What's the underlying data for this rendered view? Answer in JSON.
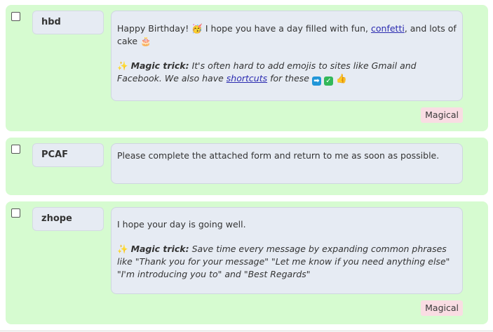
{
  "rows": [
    {
      "shortcut": "hbd",
      "message_pre": "Happy Birthday!",
      "message_mid": "I hope you have a day filled with fun,",
      "message_link": "confetti",
      "message_post": ", and lots of cake",
      "magic_label": "Magic trick:",
      "magic_text_pre": "It's often hard to add emojis to sites like Gmail and Facebook. We also have",
      "magic_link": "shortcuts",
      "magic_text_post": "for these",
      "tag": "Magical",
      "emojis": [
        "party-face-icon",
        "cake-icon",
        "sparkles-icon",
        "arrow-right-icon",
        "check-box-icon",
        "thumbs-up-icon"
      ]
    },
    {
      "shortcut": "PCAF",
      "message": "Please complete the attached form and return to me as soon as possible."
    },
    {
      "shortcut": "zhope",
      "message": "I hope your day is going well.",
      "magic_label": "Magic trick:",
      "magic_text": "Save time every message by expanding common phrases like \"Thank you for your message\" \"Let me know if you need anything else\" \"I'm introducing you to\" and \"Best Regards\"",
      "tag": "Magical",
      "emojis": [
        "sparkles-icon"
      ]
    }
  ],
  "colors": {
    "card_bg": "#d6fbd0",
    "box_bg": "#e6ebf3",
    "tag_bg": "#f9dde3",
    "link": "#2b2bb0"
  }
}
